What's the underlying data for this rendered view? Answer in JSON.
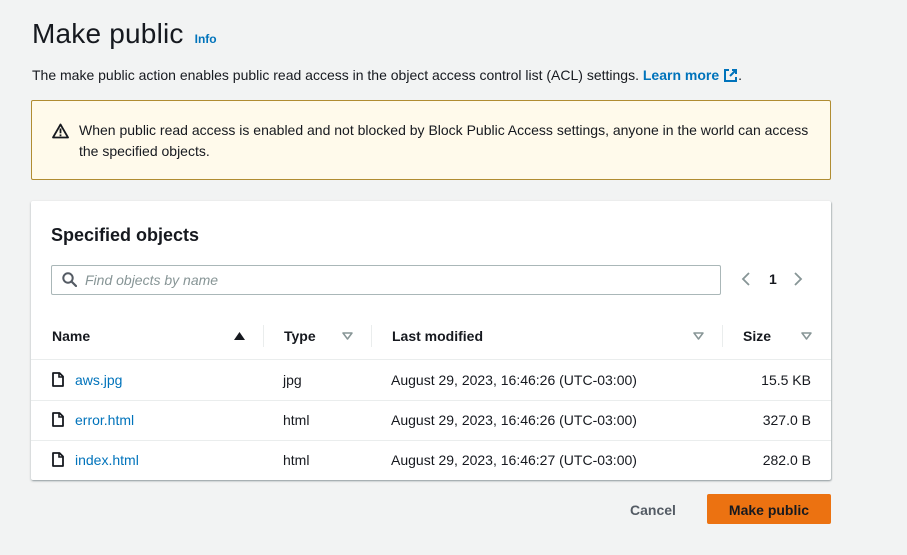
{
  "header": {
    "title": "Make public",
    "info_label": "Info",
    "description": "The make public action enables public read access in the object access control list (ACL) settings.",
    "learn_more_label": "Learn more",
    "description_end": "."
  },
  "alert": {
    "icon": "warning-icon",
    "text": "When public read access is enabled and not blocked by Block Public Access settings, anyone in the world can access the specified objects."
  },
  "objects_panel": {
    "title": "Specified objects",
    "search": {
      "placeholder": "Find objects by name",
      "value": ""
    },
    "pagination": {
      "current_page": "1"
    },
    "columns": [
      {
        "label": "Name",
        "sort": "ascending"
      },
      {
        "label": "Type",
        "sort": "none"
      },
      {
        "label": "Last modified",
        "sort": "none"
      },
      {
        "label": "Size",
        "sort": "none"
      }
    ],
    "rows": [
      {
        "name": "aws.jpg",
        "type": "jpg",
        "last_modified": "August 29, 2023, 16:46:26 (UTC-03:00)",
        "size": "15.5 KB"
      },
      {
        "name": "error.html",
        "type": "html",
        "last_modified": "August 29, 2023, 16:46:26 (UTC-03:00)",
        "size": "327.0 B"
      },
      {
        "name": "index.html",
        "type": "html",
        "last_modified": "August 29, 2023, 16:46:27 (UTC-03:00)",
        "size": "282.0 B"
      }
    ]
  },
  "footer": {
    "cancel_label": "Cancel",
    "make_public_label": "Make public"
  },
  "colors": {
    "link": "#0073bb",
    "primary_button": "#ec7211",
    "alert_background": "#fffaeb",
    "alert_border": "#b08c32"
  }
}
